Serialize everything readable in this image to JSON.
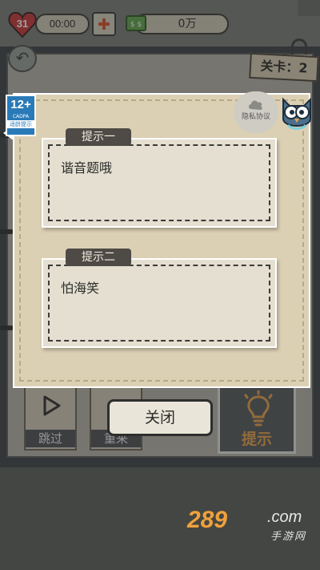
{
  "status": {
    "lives": "31",
    "timer": "00:00",
    "money": "0万"
  },
  "level": {
    "label": "关卡：2"
  },
  "bottom_buttons": {
    "skip": "跳过",
    "redo": "重来",
    "hint": "提示"
  },
  "hints": [
    {
      "title": "提示一",
      "text": "谐音题哦"
    },
    {
      "title": "提示二",
      "text": "怕海笑"
    }
  ],
  "modal": {
    "close_label": "关闭"
  },
  "age_badge": {
    "rating": "12+",
    "org": "CADPA",
    "note": "适龄提示"
  },
  "privacy": {
    "label": "隐私协议"
  },
  "watermark": {
    "num": "289",
    "com": ".com",
    "sub": "手游网"
  },
  "colors": {
    "accent_orange": "#e9a24b",
    "plus_red": "#d9532b",
    "badge_blue": "#2a7ab8"
  }
}
